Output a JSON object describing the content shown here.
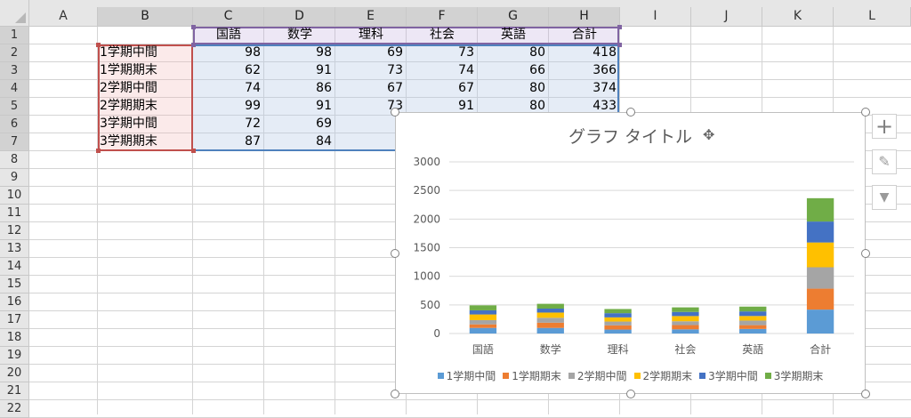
{
  "sheet": {
    "columns": [
      "A",
      "B",
      "C",
      "D",
      "E",
      "F",
      "G",
      "H",
      "I",
      "J",
      "K",
      "L"
    ],
    "rows": [
      "1",
      "2",
      "3",
      "4",
      "5",
      "6",
      "7",
      "8",
      "9",
      "10",
      "11",
      "12",
      "13",
      "14",
      "15",
      "16",
      "17",
      "18",
      "19",
      "20",
      "21",
      "22"
    ],
    "header_row": [
      "国語",
      "数学",
      "理科",
      "社会",
      "英語",
      "合計"
    ],
    "data_rows": [
      {
        "label": "1学期中間",
        "values": [
          "98",
          "98",
          "69",
          "73",
          "80",
          "418"
        ]
      },
      {
        "label": "1学期期末",
        "values": [
          "62",
          "91",
          "73",
          "74",
          "66",
          "366"
        ]
      },
      {
        "label": "2学期中間",
        "values": [
          "74",
          "86",
          "67",
          "67",
          "80",
          "374"
        ]
      },
      {
        "label": "2学期期末",
        "values": [
          "99",
          "91",
          "73",
          "91",
          "80",
          "433"
        ]
      },
      {
        "label": "3学期中間",
        "values": [
          "72",
          "69",
          "7",
          "",
          "",
          ""
        ]
      },
      {
        "label": "3学期期末",
        "values": [
          "87",
          "84",
          "7",
          "",
          "",
          ""
        ]
      }
    ]
  },
  "chart_data": {
    "type": "bar",
    "stacked": true,
    "title": "グラフ タイトル",
    "categories": [
      "国語",
      "数学",
      "理科",
      "社会",
      "英語",
      "合計"
    ],
    "ylim": [
      0,
      3000
    ],
    "yticks": [
      "0",
      "500",
      "1000",
      "1500",
      "2000",
      "2500",
      "3000"
    ],
    "series": [
      {
        "name": "1学期中間",
        "color": "#5b9bd5",
        "values": [
          98,
          98,
          69,
          73,
          80,
          418
        ]
      },
      {
        "name": "1学期期末",
        "color": "#ed7d31",
        "values": [
          62,
          91,
          73,
          74,
          66,
          366
        ]
      },
      {
        "name": "2学期中間",
        "color": "#a5a5a5",
        "values": [
          74,
          86,
          67,
          67,
          80,
          374
        ]
      },
      {
        "name": "2学期期末",
        "color": "#ffc000",
        "values": [
          99,
          91,
          73,
          91,
          80,
          433
        ]
      },
      {
        "name": "3学期中間",
        "color": "#4472c4",
        "values": [
          72,
          69,
          73,
          72,
          80,
          366
        ]
      },
      {
        "name": "3学期期末",
        "color": "#70ad47",
        "values": [
          87,
          84,
          73,
          80,
          84,
          408
        ]
      }
    ],
    "grid": true,
    "legend": "bottom"
  },
  "chart_tools": {
    "add_element": "+",
    "style": "✎",
    "filter": "▼"
  },
  "colors": {
    "label_range": "#c0504d",
    "header_range": "#8064a2",
    "value_range": "#4f81bd"
  }
}
